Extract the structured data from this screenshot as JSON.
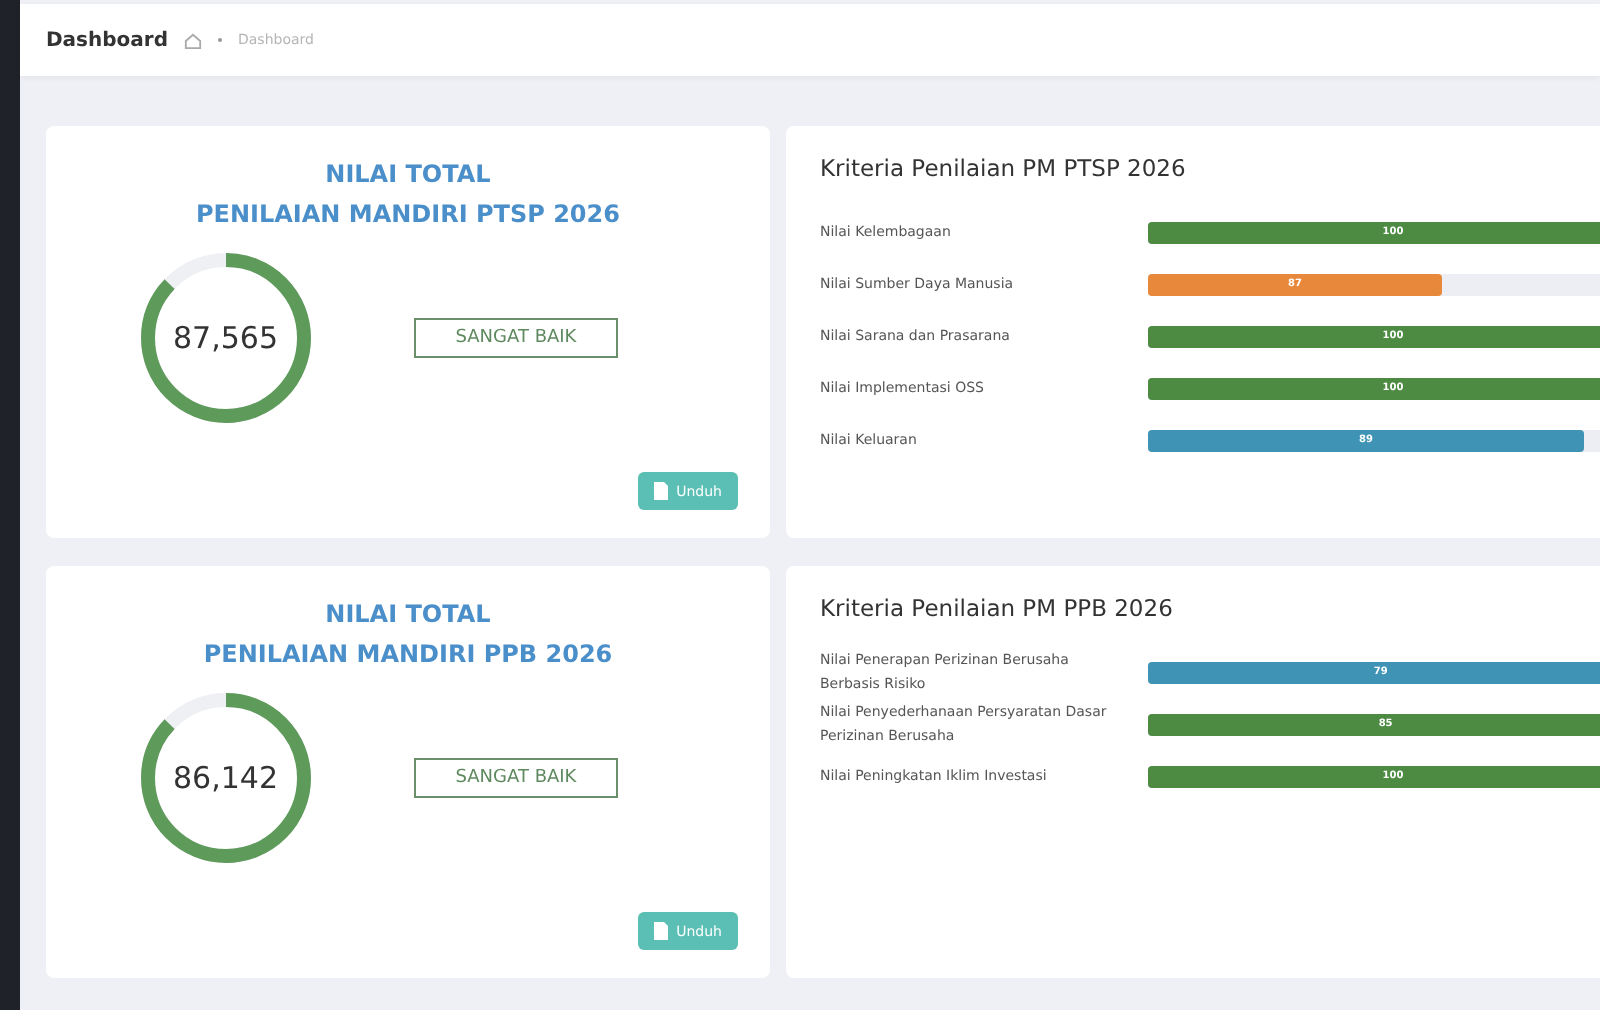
{
  "header": {
    "title": "Dashboard",
    "breadcrumb": "Dashboard"
  },
  "sections": [
    {
      "summary": {
        "title_line_1": "NILAI TOTAL",
        "title_line_2": "PENILAIAN MANDIRI PTSP 2026",
        "score": "87,565",
        "rating": "SANGAT BAIK",
        "button": "Unduh"
      },
      "criteria": {
        "title": "Kriteria Penilaian PM PTSP 2026",
        "items": [
          {
            "label": "Nilai Kelembagaan",
            "value": "100",
            "level": 1,
            "color": "#4d8b43"
          },
          {
            "label": "Nilai Sumber Daya Manusia",
            "value": "87",
            "level": 0.6,
            "color": "#e8883a"
          },
          {
            "label": "Nilai Sarana dan Prasarana",
            "value": "100",
            "level": 1,
            "color": "#4d8b43"
          },
          {
            "label": "Nilai Implementasi OSS",
            "value": "100",
            "level": 1,
            "color": "#4d8b43"
          },
          {
            "label": "Nilai Keluaran",
            "value": "89",
            "level": 0.89,
            "color": "#3f93b5"
          }
        ]
      }
    },
    {
      "summary": {
        "title_line_1": "NILAI TOTAL",
        "title_line_2": "PENILAIAN MANDIRI PPB 2026",
        "score": "86,142",
        "rating": "SANGAT BAIK",
        "button": "Unduh"
      },
      "criteria": {
        "title": "Kriteria Penilaian PM PPB 2026",
        "items": [
          {
            "label": "Nilai Penerapan Perizinan Berusaha Berbasis Risiko",
            "value": "79",
            "level": 0.95,
            "color": "#3f93b5"
          },
          {
            "label": "Nilai Penyederhanaan Persyaratan Dasar Perizinan Berusaha",
            "value": "85",
            "level": 0.97,
            "color": "#4d8b43"
          },
          {
            "label": "Nilai Peningkatan Iklim Investasi",
            "value": "100",
            "level": 1,
            "color": "#4d8b43"
          }
        ]
      }
    }
  ]
}
